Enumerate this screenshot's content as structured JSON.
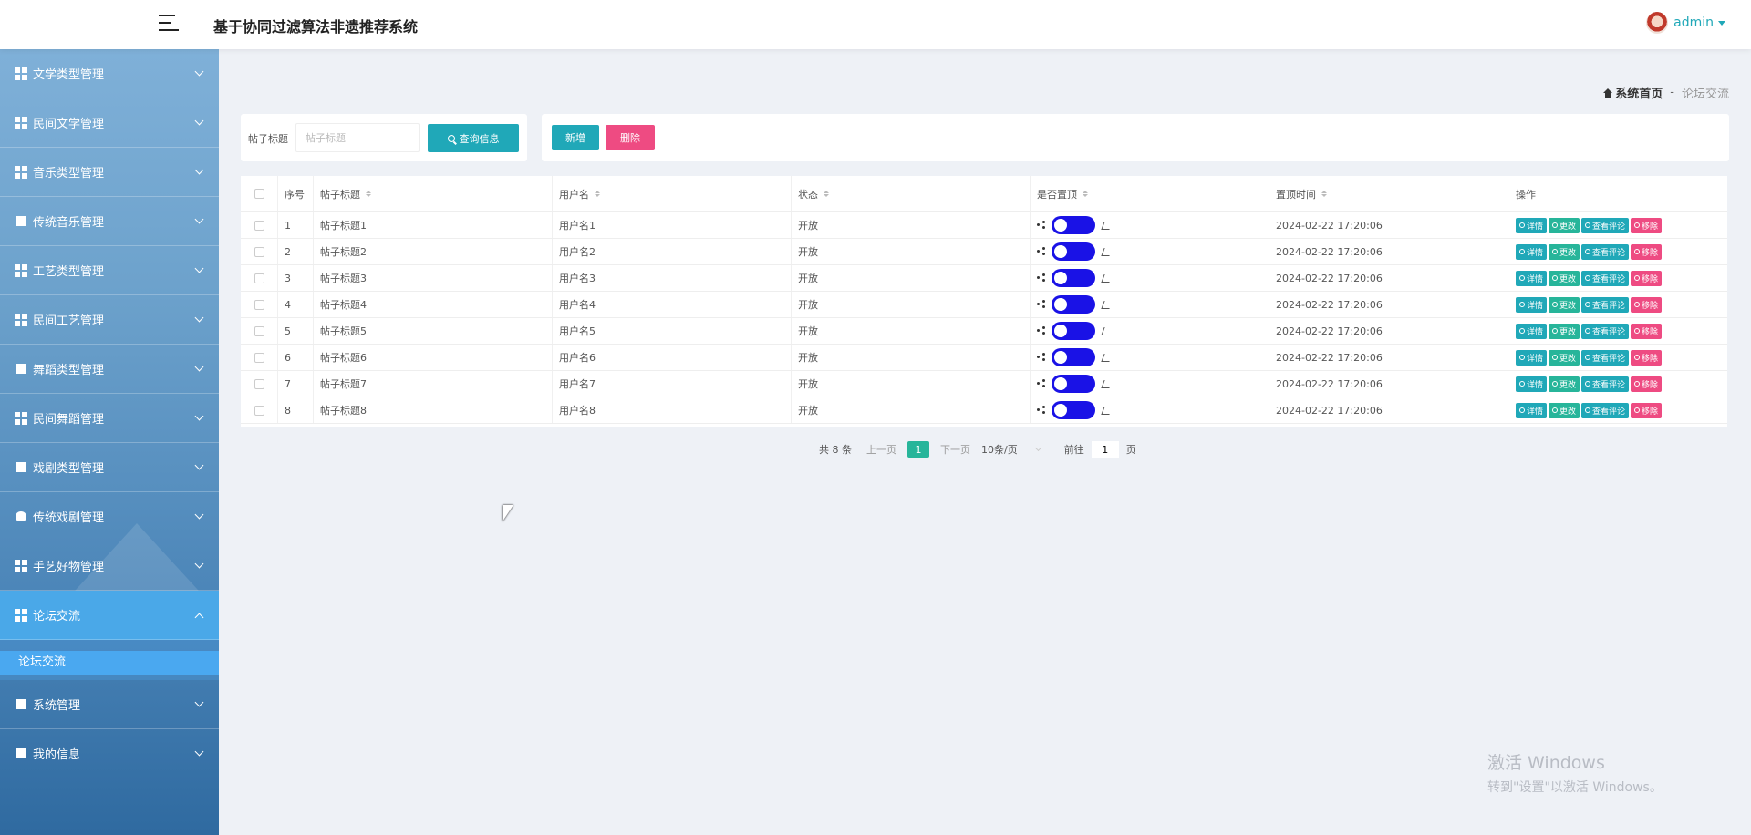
{
  "header": {
    "title": "基于协同过滤算法非遗推荐系统",
    "user": "admin"
  },
  "sidebar": {
    "items": [
      {
        "label": "文学类型管理",
        "icon": "grid-icon"
      },
      {
        "label": "民间文学管理",
        "icon": "grid-icon"
      },
      {
        "label": "音乐类型管理",
        "icon": "grid-icon"
      },
      {
        "label": "传统音乐管理",
        "icon": "clipboard-icon"
      },
      {
        "label": "工艺类型管理",
        "icon": "grid-icon"
      },
      {
        "label": "民间工艺管理",
        "icon": "grid-icon"
      },
      {
        "label": "舞蹈类型管理",
        "icon": "monitor-icon"
      },
      {
        "label": "民间舞蹈管理",
        "icon": "grid-icon"
      },
      {
        "label": "戏剧类型管理",
        "icon": "building-icon"
      },
      {
        "label": "传统戏剧管理",
        "icon": "bulb-icon"
      },
      {
        "label": "手艺好物管理",
        "icon": "grid-icon"
      },
      {
        "label": "论坛交流",
        "icon": "grid-icon"
      }
    ],
    "submenu_label": "论坛交流",
    "bottom_items": [
      {
        "label": "系统管理",
        "icon": "bar-chart-icon"
      },
      {
        "label": "我的信息",
        "icon": "card-icon"
      }
    ]
  },
  "breadcrumb": {
    "home": "系统首页",
    "separator": "-",
    "current": "论坛交流"
  },
  "search": {
    "label": "帖子标题",
    "placeholder": "帖子标题",
    "button": "查询信息"
  },
  "actions": {
    "add": "新增",
    "delete": "删除"
  },
  "table": {
    "headers": [
      "序号",
      "帖子标题",
      "用户名",
      "状态",
      "是否置顶",
      "置顶时间",
      "操作"
    ],
    "rows": [
      {
        "no": "1",
        "title": "帖子标题1",
        "user": "用户名1",
        "status": "开放",
        "time": "2024-02-22 17:20:06"
      },
      {
        "no": "2",
        "title": "帖子标题2",
        "user": "用户名2",
        "status": "开放",
        "time": "2024-02-22 17:20:06"
      },
      {
        "no": "3",
        "title": "帖子标题3",
        "user": "用户名3",
        "status": "开放",
        "time": "2024-02-22 17:20:06"
      },
      {
        "no": "4",
        "title": "帖子标题4",
        "user": "用户名4",
        "status": "开放",
        "time": "2024-02-22 17:20:06"
      },
      {
        "no": "5",
        "title": "帖子标题5",
        "user": "用户名5",
        "status": "开放",
        "time": "2024-02-22 17:20:06"
      },
      {
        "no": "6",
        "title": "帖子标题6",
        "user": "用户名6",
        "status": "开放",
        "time": "2024-02-22 17:20:06"
      },
      {
        "no": "7",
        "title": "帖子标题7",
        "user": "用户名7",
        "status": "开放",
        "time": "2024-02-22 17:20:06"
      },
      {
        "no": "8",
        "title": "帖子标题8",
        "user": "用户名8",
        "status": "开放",
        "time": "2024-02-22 17:20:06"
      }
    ],
    "ops": [
      "详情",
      "更改",
      "查看评论",
      "移除"
    ]
  },
  "pagination": {
    "total": "共 8 条",
    "prev": "上一页",
    "current_page": "1",
    "next": "下一页",
    "page_size": "10条/页",
    "goto_prefix": "前往",
    "goto_value": "1",
    "goto_suffix": "页"
  },
  "watermark": {
    "line1": "激活 Windows",
    "line2": "转到\"设置\"以激活 Windows。"
  },
  "colors": {
    "accent": "#20a8b8",
    "danger": "#ee4b82",
    "success": "#27b59a",
    "toggle": "#1a12e6",
    "sidebar_active": "#4aa8e8"
  }
}
